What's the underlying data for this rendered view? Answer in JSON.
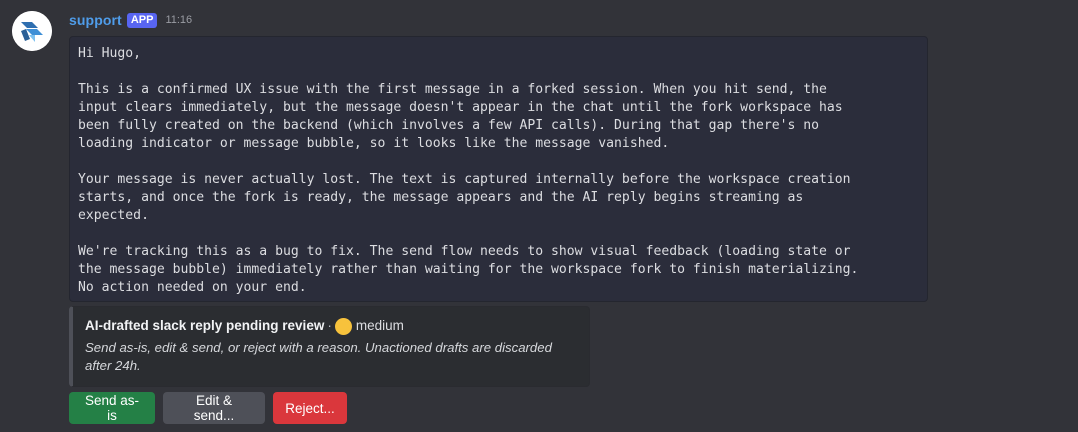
{
  "message": {
    "username": "support",
    "app_tag": "APP",
    "timestamp": "11:16",
    "avatar_icon": "support-bot-logo-icon",
    "accent_color": "#4f9dea",
    "body": "Hi Hugo,\n\nThis is a confirmed UX issue with the first message in a forked session. When you hit send, the\ninput clears immediately, but the message doesn't appear in the chat until the fork workspace has\nbeen fully created on the backend (which involves a few API calls). During that gap there's no\nloading indicator or message bubble, so it looks like the message vanished.\n\nYour message is never actually lost. The text is captured internally before the workspace creation\nstarts, and once the fork is ready, the message appears and the AI reply begins streaming as\nexpected.\n\nWe're tracking this as a bug to fix. The send flow needs to show visual feedback (loading state or\nthe message bubble) immediately rather than waiting for the workspace fork to finish materializing.\nNo action needed on your end."
  },
  "embed": {
    "title": "AI-drafted slack reply pending review",
    "separator": "·",
    "severity_icon": "yellow-circle-icon",
    "severity_color": "#f7c23c",
    "severity": "medium",
    "description": "Send as-is, edit & send, or reject with a reason. Unactioned drafts are discarded after 24h."
  },
  "buttons": {
    "send": "Send as-is",
    "edit": "Edit & send...",
    "reject": "Reject..."
  },
  "colors": {
    "send": "#248046",
    "edit": "#4e5058",
    "reject": "#da373c"
  }
}
